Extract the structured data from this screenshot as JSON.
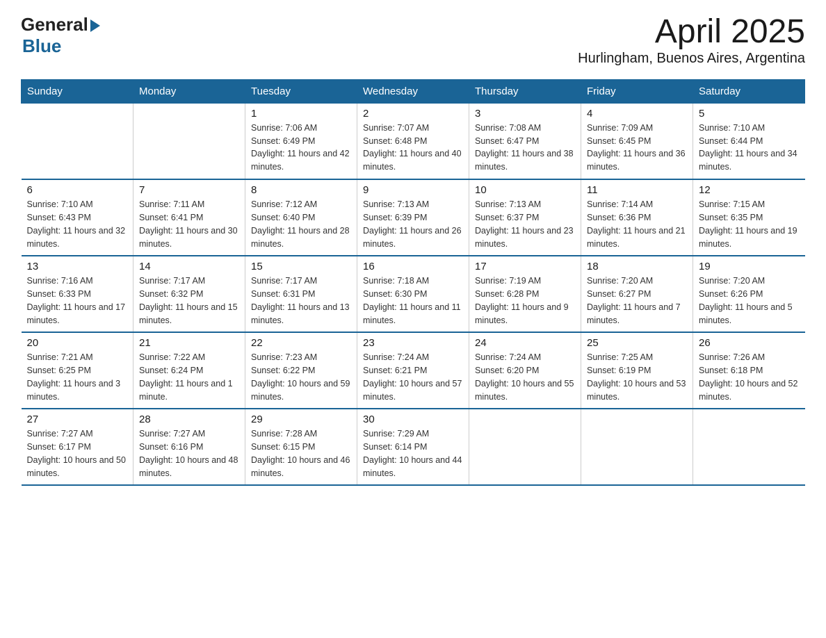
{
  "header": {
    "title": "April 2025",
    "subtitle": "Hurlingham, Buenos Aires, Argentina",
    "logo_general": "General",
    "logo_blue": "Blue"
  },
  "days_of_week": [
    "Sunday",
    "Monday",
    "Tuesday",
    "Wednesday",
    "Thursday",
    "Friday",
    "Saturday"
  ],
  "weeks": [
    [
      {
        "day": "",
        "sunrise": "",
        "sunset": "",
        "daylight": ""
      },
      {
        "day": "",
        "sunrise": "",
        "sunset": "",
        "daylight": ""
      },
      {
        "day": "1",
        "sunrise": "Sunrise: 7:06 AM",
        "sunset": "Sunset: 6:49 PM",
        "daylight": "Daylight: 11 hours and 42 minutes."
      },
      {
        "day": "2",
        "sunrise": "Sunrise: 7:07 AM",
        "sunset": "Sunset: 6:48 PM",
        "daylight": "Daylight: 11 hours and 40 minutes."
      },
      {
        "day": "3",
        "sunrise": "Sunrise: 7:08 AM",
        "sunset": "Sunset: 6:47 PM",
        "daylight": "Daylight: 11 hours and 38 minutes."
      },
      {
        "day": "4",
        "sunrise": "Sunrise: 7:09 AM",
        "sunset": "Sunset: 6:45 PM",
        "daylight": "Daylight: 11 hours and 36 minutes."
      },
      {
        "day": "5",
        "sunrise": "Sunrise: 7:10 AM",
        "sunset": "Sunset: 6:44 PM",
        "daylight": "Daylight: 11 hours and 34 minutes."
      }
    ],
    [
      {
        "day": "6",
        "sunrise": "Sunrise: 7:10 AM",
        "sunset": "Sunset: 6:43 PM",
        "daylight": "Daylight: 11 hours and 32 minutes."
      },
      {
        "day": "7",
        "sunrise": "Sunrise: 7:11 AM",
        "sunset": "Sunset: 6:41 PM",
        "daylight": "Daylight: 11 hours and 30 minutes."
      },
      {
        "day": "8",
        "sunrise": "Sunrise: 7:12 AM",
        "sunset": "Sunset: 6:40 PM",
        "daylight": "Daylight: 11 hours and 28 minutes."
      },
      {
        "day": "9",
        "sunrise": "Sunrise: 7:13 AM",
        "sunset": "Sunset: 6:39 PM",
        "daylight": "Daylight: 11 hours and 26 minutes."
      },
      {
        "day": "10",
        "sunrise": "Sunrise: 7:13 AM",
        "sunset": "Sunset: 6:37 PM",
        "daylight": "Daylight: 11 hours and 23 minutes."
      },
      {
        "day": "11",
        "sunrise": "Sunrise: 7:14 AM",
        "sunset": "Sunset: 6:36 PM",
        "daylight": "Daylight: 11 hours and 21 minutes."
      },
      {
        "day": "12",
        "sunrise": "Sunrise: 7:15 AM",
        "sunset": "Sunset: 6:35 PM",
        "daylight": "Daylight: 11 hours and 19 minutes."
      }
    ],
    [
      {
        "day": "13",
        "sunrise": "Sunrise: 7:16 AM",
        "sunset": "Sunset: 6:33 PM",
        "daylight": "Daylight: 11 hours and 17 minutes."
      },
      {
        "day": "14",
        "sunrise": "Sunrise: 7:17 AM",
        "sunset": "Sunset: 6:32 PM",
        "daylight": "Daylight: 11 hours and 15 minutes."
      },
      {
        "day": "15",
        "sunrise": "Sunrise: 7:17 AM",
        "sunset": "Sunset: 6:31 PM",
        "daylight": "Daylight: 11 hours and 13 minutes."
      },
      {
        "day": "16",
        "sunrise": "Sunrise: 7:18 AM",
        "sunset": "Sunset: 6:30 PM",
        "daylight": "Daylight: 11 hours and 11 minutes."
      },
      {
        "day": "17",
        "sunrise": "Sunrise: 7:19 AM",
        "sunset": "Sunset: 6:28 PM",
        "daylight": "Daylight: 11 hours and 9 minutes."
      },
      {
        "day": "18",
        "sunrise": "Sunrise: 7:20 AM",
        "sunset": "Sunset: 6:27 PM",
        "daylight": "Daylight: 11 hours and 7 minutes."
      },
      {
        "day": "19",
        "sunrise": "Sunrise: 7:20 AM",
        "sunset": "Sunset: 6:26 PM",
        "daylight": "Daylight: 11 hours and 5 minutes."
      }
    ],
    [
      {
        "day": "20",
        "sunrise": "Sunrise: 7:21 AM",
        "sunset": "Sunset: 6:25 PM",
        "daylight": "Daylight: 11 hours and 3 minutes."
      },
      {
        "day": "21",
        "sunrise": "Sunrise: 7:22 AM",
        "sunset": "Sunset: 6:24 PM",
        "daylight": "Daylight: 11 hours and 1 minute."
      },
      {
        "day": "22",
        "sunrise": "Sunrise: 7:23 AM",
        "sunset": "Sunset: 6:22 PM",
        "daylight": "Daylight: 10 hours and 59 minutes."
      },
      {
        "day": "23",
        "sunrise": "Sunrise: 7:24 AM",
        "sunset": "Sunset: 6:21 PM",
        "daylight": "Daylight: 10 hours and 57 minutes."
      },
      {
        "day": "24",
        "sunrise": "Sunrise: 7:24 AM",
        "sunset": "Sunset: 6:20 PM",
        "daylight": "Daylight: 10 hours and 55 minutes."
      },
      {
        "day": "25",
        "sunrise": "Sunrise: 7:25 AM",
        "sunset": "Sunset: 6:19 PM",
        "daylight": "Daylight: 10 hours and 53 minutes."
      },
      {
        "day": "26",
        "sunrise": "Sunrise: 7:26 AM",
        "sunset": "Sunset: 6:18 PM",
        "daylight": "Daylight: 10 hours and 52 minutes."
      }
    ],
    [
      {
        "day": "27",
        "sunrise": "Sunrise: 7:27 AM",
        "sunset": "Sunset: 6:17 PM",
        "daylight": "Daylight: 10 hours and 50 minutes."
      },
      {
        "day": "28",
        "sunrise": "Sunrise: 7:27 AM",
        "sunset": "Sunset: 6:16 PM",
        "daylight": "Daylight: 10 hours and 48 minutes."
      },
      {
        "day": "29",
        "sunrise": "Sunrise: 7:28 AM",
        "sunset": "Sunset: 6:15 PM",
        "daylight": "Daylight: 10 hours and 46 minutes."
      },
      {
        "day": "30",
        "sunrise": "Sunrise: 7:29 AM",
        "sunset": "Sunset: 6:14 PM",
        "daylight": "Daylight: 10 hours and 44 minutes."
      },
      {
        "day": "",
        "sunrise": "",
        "sunset": "",
        "daylight": ""
      },
      {
        "day": "",
        "sunrise": "",
        "sunset": "",
        "daylight": ""
      },
      {
        "day": "",
        "sunrise": "",
        "sunset": "",
        "daylight": ""
      }
    ]
  ]
}
